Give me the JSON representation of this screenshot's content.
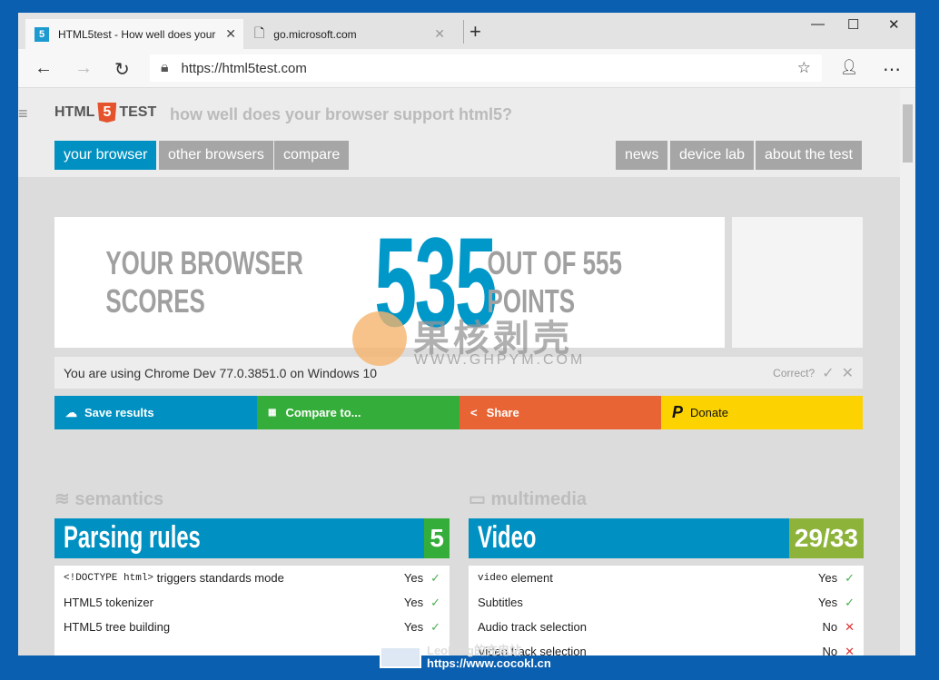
{
  "browser": {
    "tabs": [
      {
        "title": "HTML5test - How well does your",
        "icon": "html5-icon"
      },
      {
        "title": "go.microsoft.com",
        "icon": "page-error-icon"
      }
    ],
    "url": "https://html5test.com"
  },
  "site": {
    "logo_left": "HTML",
    "logo_num": "5",
    "logo_right": "TEST",
    "tagline": "how well does your browser support html5?",
    "nav_left": [
      "your browser",
      "other browsers",
      "compare"
    ],
    "nav_right": [
      "news",
      "device lab",
      "about the test"
    ]
  },
  "score": {
    "prefix": "YOUR BROWSER SCORES",
    "value": "535",
    "suffix": "OUT OF 555 POINTS"
  },
  "info": {
    "text": "You are using Chrome Dev 77.0.3851.0 on Windows 10",
    "correct": "Correct?"
  },
  "actions": [
    {
      "label": "Save results",
      "color": "#0091c2",
      "icon": "cloud-upload-icon"
    },
    {
      "label": "Compare to...",
      "color": "#35ad3a",
      "icon": "grid-icon"
    },
    {
      "label": "Share",
      "color": "#e96434",
      "icon": "share-icon"
    },
    {
      "label": "Donate",
      "color": "#fcd300",
      "icon": "paypal-icon"
    }
  ],
  "sections": [
    {
      "heading": "semantics",
      "title": "Parsing rules",
      "score": "5",
      "score_color": "#35ad3a",
      "rows": [
        {
          "code": "<!DOCTYPE html>",
          "label": " triggers standards mode",
          "result": "Yes"
        },
        {
          "code": "",
          "label": "HTML5 tokenizer",
          "result": "Yes"
        },
        {
          "code": "",
          "label": "HTML5 tree building",
          "result": "Yes"
        }
      ]
    },
    {
      "heading": "multimedia",
      "title": "Video",
      "score": "29/33",
      "score_color": "#8db33a",
      "rows": [
        {
          "code": "video",
          "label": " element",
          "result": "Yes"
        },
        {
          "code": "",
          "label": "Subtitles",
          "result": "Yes"
        },
        {
          "code": "",
          "label": "Audio track selection",
          "result": "No"
        },
        {
          "code": "",
          "label": "Video track selection",
          "result": "No"
        }
      ]
    }
  ],
  "watermarks": {
    "cn": "果核剥壳",
    "url": "WWW.GHPYM.COM",
    "bottom1": "LeoKing的充电站",
    "bottom2": "https://www.cocokl.cn"
  }
}
